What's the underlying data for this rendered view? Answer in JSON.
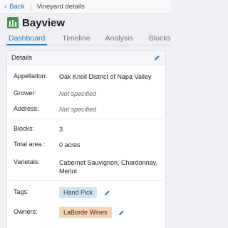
{
  "topbar": {
    "back_label": "Back",
    "breadcrumb": "Vineyard details"
  },
  "header": {
    "title": "Bayview",
    "icon": "vineyard-icon"
  },
  "tabs": [
    {
      "label": "Dashboard",
      "active": true
    },
    {
      "label": "Timeline",
      "active": false
    },
    {
      "label": "Analysis",
      "active": false
    },
    {
      "label": "Blocks",
      "active": false
    }
  ],
  "details": {
    "heading": "Details",
    "appellation_label": "Appellation:",
    "appellation_value": "Oak Knoll District of Napa Valley",
    "grower_label": "Grower:",
    "grower_value": "Not specified",
    "address_label": "Address:",
    "address_value": "Not specified",
    "blocks_label": "Blocks:",
    "blocks_value": "3",
    "total_area_label": "Total area :",
    "total_area_value": "0 acres",
    "varietals_label": "Varietals:",
    "varietals_value": "Cabernet Sauvignon, Chardonnay, Merlot",
    "tags_label": "Tags:",
    "tags": [
      "Hand Pick"
    ],
    "owners_label": "Owners:",
    "owners": [
      "LaBorde Wines"
    ]
  },
  "colors": {
    "accent": "#2d7ab8",
    "tag_bg": "#cfe6f6",
    "owner_bg": "#f3d5b4",
    "brand_green": "#3a9a4a"
  }
}
